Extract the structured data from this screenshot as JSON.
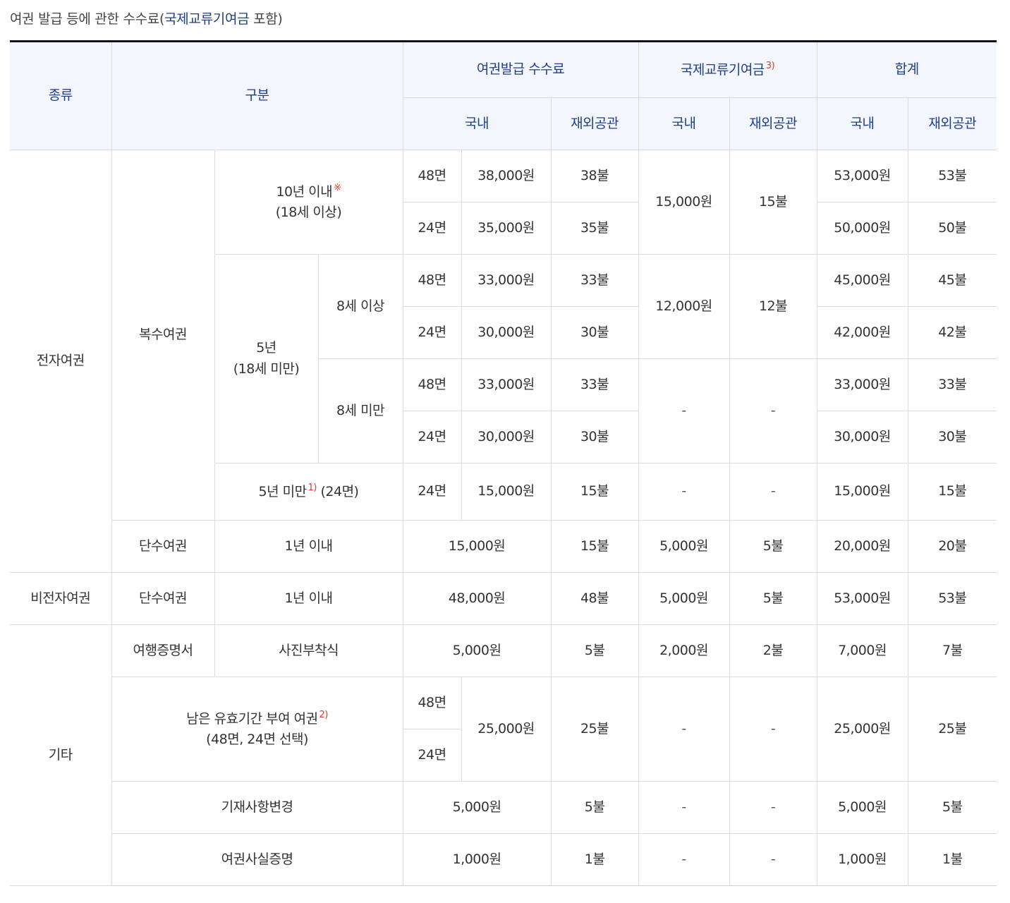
{
  "caption": {
    "prefix": "여권 발급 등에 관한 수수료(",
    "highlight": "국제교류기여금",
    "suffix": " 포함)"
  },
  "colors": {
    "header_bg": "#f3f6fc",
    "header_text": "#1f3f8a",
    "footnote": "#e23b2a",
    "top_rule": "#111111"
  },
  "header": {
    "kind": "종류",
    "division": "구분",
    "issuance_fee": "여권발급 수수료",
    "intl_contribution": "국제교류기여금",
    "intl_contribution_note": "3)",
    "total": "합계",
    "domestic": "국내",
    "overseas": "재외공관"
  },
  "labels": {
    "electronic": "전자여권",
    "non_electronic": "비전자여권",
    "other": "기타",
    "multiple": "복수여권",
    "single": "단수여권",
    "travel_cert": "여행증명서",
    "ten_years": "10년 이내",
    "ten_years_mark": "※",
    "adult": "(18세 이상)",
    "five_years": "5년",
    "minor": "(18세 미만)",
    "age8_over": "8세 이상",
    "age8_under": "8세 미만",
    "under5_a": "5년 미만",
    "under5_note": "1)",
    "under5_b": " (24면)",
    "one_year": "1년 이내",
    "photo": "사진부착식",
    "remaining_a": "남은 유효기간 부여 여권",
    "remaining_note": "2)",
    "remaining_b": "(48면, 24면 선택)",
    "record_change": "기재사항변경",
    "fact_cert": "여권사실증명",
    "p48": "48면",
    "p24": "24면",
    "dash": "-"
  },
  "values": {
    "r1": {
      "fee_d": "38,000원",
      "fee_o": "38불",
      "total_d": "53,000원",
      "total_o": "53불"
    },
    "r2": {
      "fee_d": "35,000원",
      "fee_o": "35불",
      "total_d": "50,000원",
      "total_o": "50불"
    },
    "c10": {
      "d": "15,000원",
      "o": "15불"
    },
    "r3": {
      "fee_d": "33,000원",
      "fee_o": "33불",
      "total_d": "45,000원",
      "total_o": "45불"
    },
    "r4": {
      "fee_d": "30,000원",
      "fee_o": "30불",
      "total_d": "42,000원",
      "total_o": "42불"
    },
    "c5": {
      "d": "12,000원",
      "o": "12불"
    },
    "r5": {
      "fee_d": "33,000원",
      "fee_o": "33불",
      "total_d": "33,000원",
      "total_o": "33불"
    },
    "r6": {
      "fee_d": "30,000원",
      "fee_o": "30불",
      "total_d": "30,000원",
      "total_o": "30불"
    },
    "r7": {
      "fee_d": "15,000원",
      "fee_o": "15불",
      "total_d": "15,000원",
      "total_o": "15불"
    },
    "r8": {
      "fee_d": "15,000원",
      "fee_o": "15불",
      "c_d": "5,000원",
      "c_o": "5불",
      "total_d": "20,000원",
      "total_o": "20불"
    },
    "r9": {
      "fee_d": "48,000원",
      "fee_o": "48불",
      "c_d": "5,000원",
      "c_o": "5불",
      "total_d": "53,000원",
      "total_o": "53불"
    },
    "r10": {
      "fee_d": "5,000원",
      "fee_o": "5불",
      "c_d": "2,000원",
      "c_o": "2불",
      "total_d": "7,000원",
      "total_o": "7불"
    },
    "r11": {
      "fee_d": "25,000원",
      "fee_o": "25불",
      "total_d": "25,000원",
      "total_o": "25불"
    },
    "r13": {
      "fee_d": "5,000원",
      "fee_o": "5불",
      "total_d": "5,000원",
      "total_o": "5불"
    },
    "r14": {
      "fee_d": "1,000원",
      "fee_o": "1불",
      "total_d": "1,000원",
      "total_o": "1불"
    }
  }
}
